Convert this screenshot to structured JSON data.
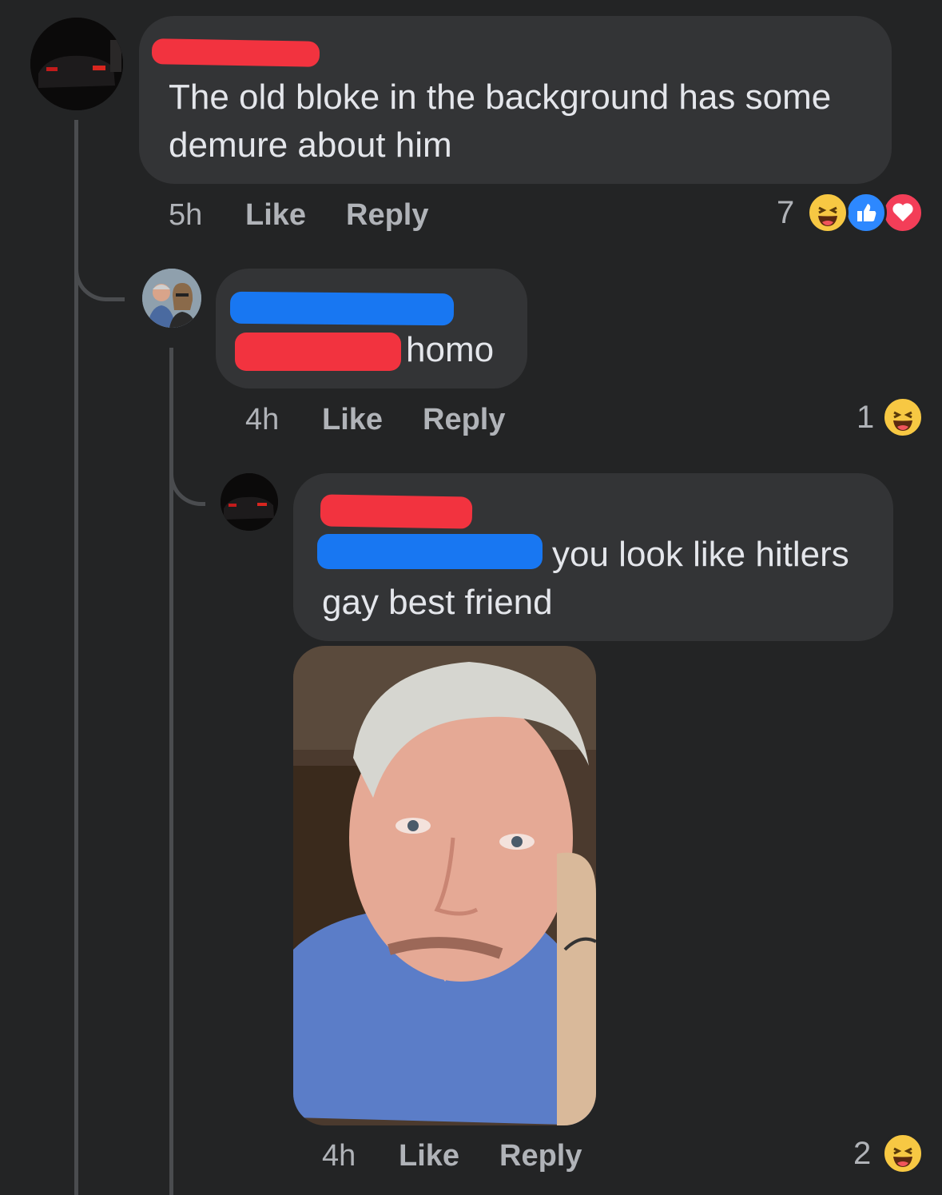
{
  "comments": [
    {
      "text": "The old bloke in the background has some demure about him",
      "line1": "The old bloke in the background has some",
      "line2": "demure about him",
      "time": "5h",
      "like_label": "Like",
      "reply_label": "Reply",
      "reaction_count": "7",
      "reactions": [
        "haha",
        "like",
        "love"
      ]
    },
    {
      "text": "homo",
      "time": "4h",
      "like_label": "Like",
      "reply_label": "Reply",
      "reaction_count": "1",
      "reactions": [
        "haha"
      ]
    },
    {
      "line1": "you look like hitlers",
      "line2": "gay best friend",
      "time": "4h",
      "like_label": "Like",
      "reply_label": "Reply",
      "reaction_count": "2",
      "reactions": [
        "haha"
      ]
    }
  ],
  "colors": {
    "background": "#232425",
    "bubble": "#333436",
    "redact_red": "#f2333f",
    "redact_blue": "#1877f2",
    "meta_text": "#b0b3b8"
  }
}
